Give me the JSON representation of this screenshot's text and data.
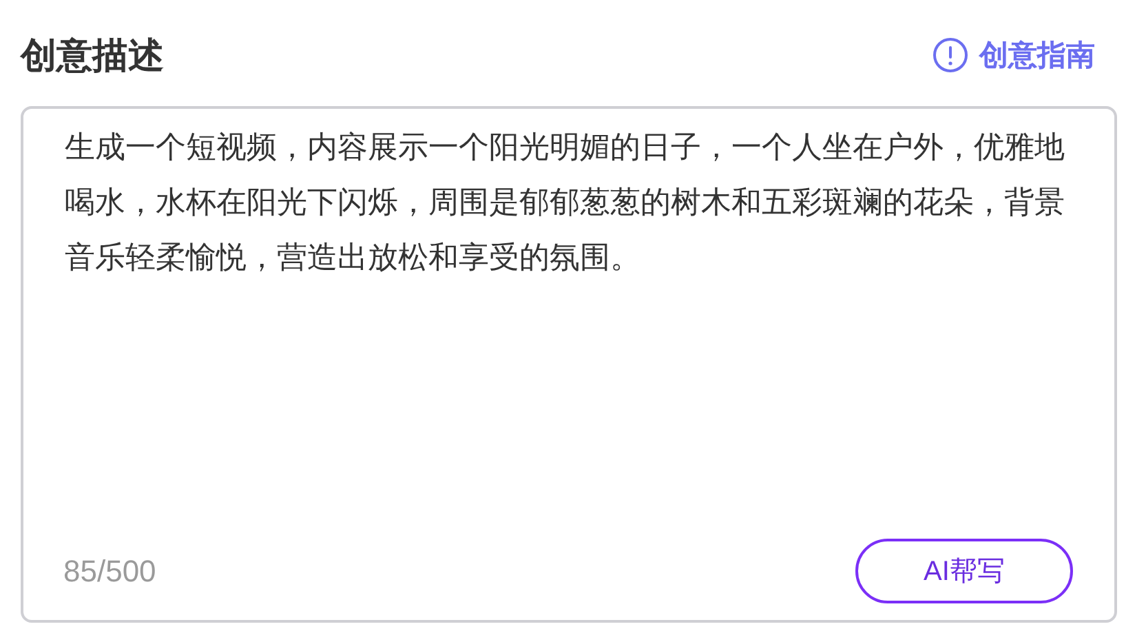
{
  "title": "创意描述",
  "guide_link": {
    "label": "创意指南"
  },
  "description": {
    "value": "生成一个短视频，内容展示一个阳光明媚的日子，一个人坐在户外，优雅地喝水，水杯在阳光下闪烁，周围是郁郁葱葱的树木和五彩斑斓的花朵，背景音乐轻柔愉悦，营造出放松和享受的氛围。",
    "counter": "85/500"
  },
  "ai_button": {
    "label": "AI帮写"
  }
}
